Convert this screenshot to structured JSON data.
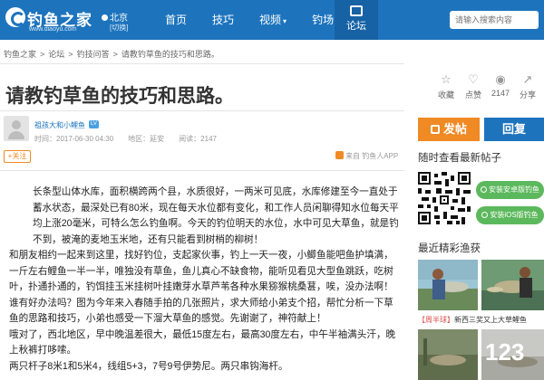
{
  "header": {
    "logo_text": "钓鱼之家",
    "logo_sub": "www.diaoyu.com",
    "city": "北京",
    "city_switch": "[切换]",
    "nav": [
      {
        "label": "首页"
      },
      {
        "label": "技巧"
      },
      {
        "label": "视频"
      },
      {
        "label": "钓场"
      }
    ],
    "forum": "论坛",
    "search_placeholder": "请输入搜索内容"
  },
  "breadcrumb": [
    "钓鱼之家",
    ">",
    "论坛",
    ">",
    "钓技问答",
    ">",
    "请教钓草鱼的技巧和思路。"
  ],
  "post": {
    "title": "请教钓草鱼的技巧和思路。",
    "stats": {
      "fav_label": "收藏",
      "like_label": "点赞",
      "views": "2147",
      "share_label": "分享"
    },
    "author": "祖孩大和小鲤鱼",
    "level": "LV",
    "time": "时间：2017-06-30 04:30",
    "region": "地区：延安",
    "reads": "阅读：2147",
    "follow": "+关注",
    "source": "来自 钓鱼人APP",
    "paragraphs": [
      "长条型山体水库，面积横跨两个县，水质很好，一两米可见底，水库修建至今一直处于蓄水状态，最深处已有80米，现在每天水位都有变化，和工作人员闲聊得知水位每天平均上涨20毫米，可特么怎么钓鱼啊。今天的钓位明天的水位，水中可见大草鱼，就是钓不到，被淹的麦地玉米地，还有只能看到树梢的柳树！",
      "和朋友相约一起来到这里，找好钓位，支起家伙事，钓上一天一夜，小鲫鱼能吧鱼护填满，一斤左右鲤鱼一半一半，唯独没有草鱼，鱼儿真心不缺食物，能听见看见大型鱼跳跃，吃树叶，扑通扑通的，钓饵挂玉米挂树叶挂嫩芽水草芦苇各种水果猕猴桃桑葚，唉，没办法啊！谁有好办法吗？图为今年来入春随手拍的几张照片，求大师给小弟支个招，帮忙分析一下草鱼的思路和技巧，小弟也感受一下溜大草鱼的感觉。先谢谢了，神符献上！",
      "哦对了，西北地区，早中晚温差很大，最低15度左右，最高30度左右，中午半袖满头汗，晚上秋裤打哆嗦。",
      "两只杆子8米1和5米4，线组5+3，7号9号伊势尼。两只串钩海杆。"
    ]
  },
  "sidebar": {
    "post_btn": "发帖",
    "reply_btn": "回复",
    "section_new": "随时查看最新帖子",
    "android_btn": "安装安卓版钓鱼",
    "ios_btn": "安装iOS版钓鱼",
    "section_photos": "最近精彩渔获",
    "captions": [
      {
        "tag": "【周半球】",
        "text": "新西三奖"
      },
      {
        "tag": "",
        "text": "又上大草鲤鱼"
      }
    ],
    "photo_overlay": "123"
  },
  "colors": {
    "brand": "#1d74bd",
    "accent": "#f08a24",
    "green": "#5cb85c"
  }
}
